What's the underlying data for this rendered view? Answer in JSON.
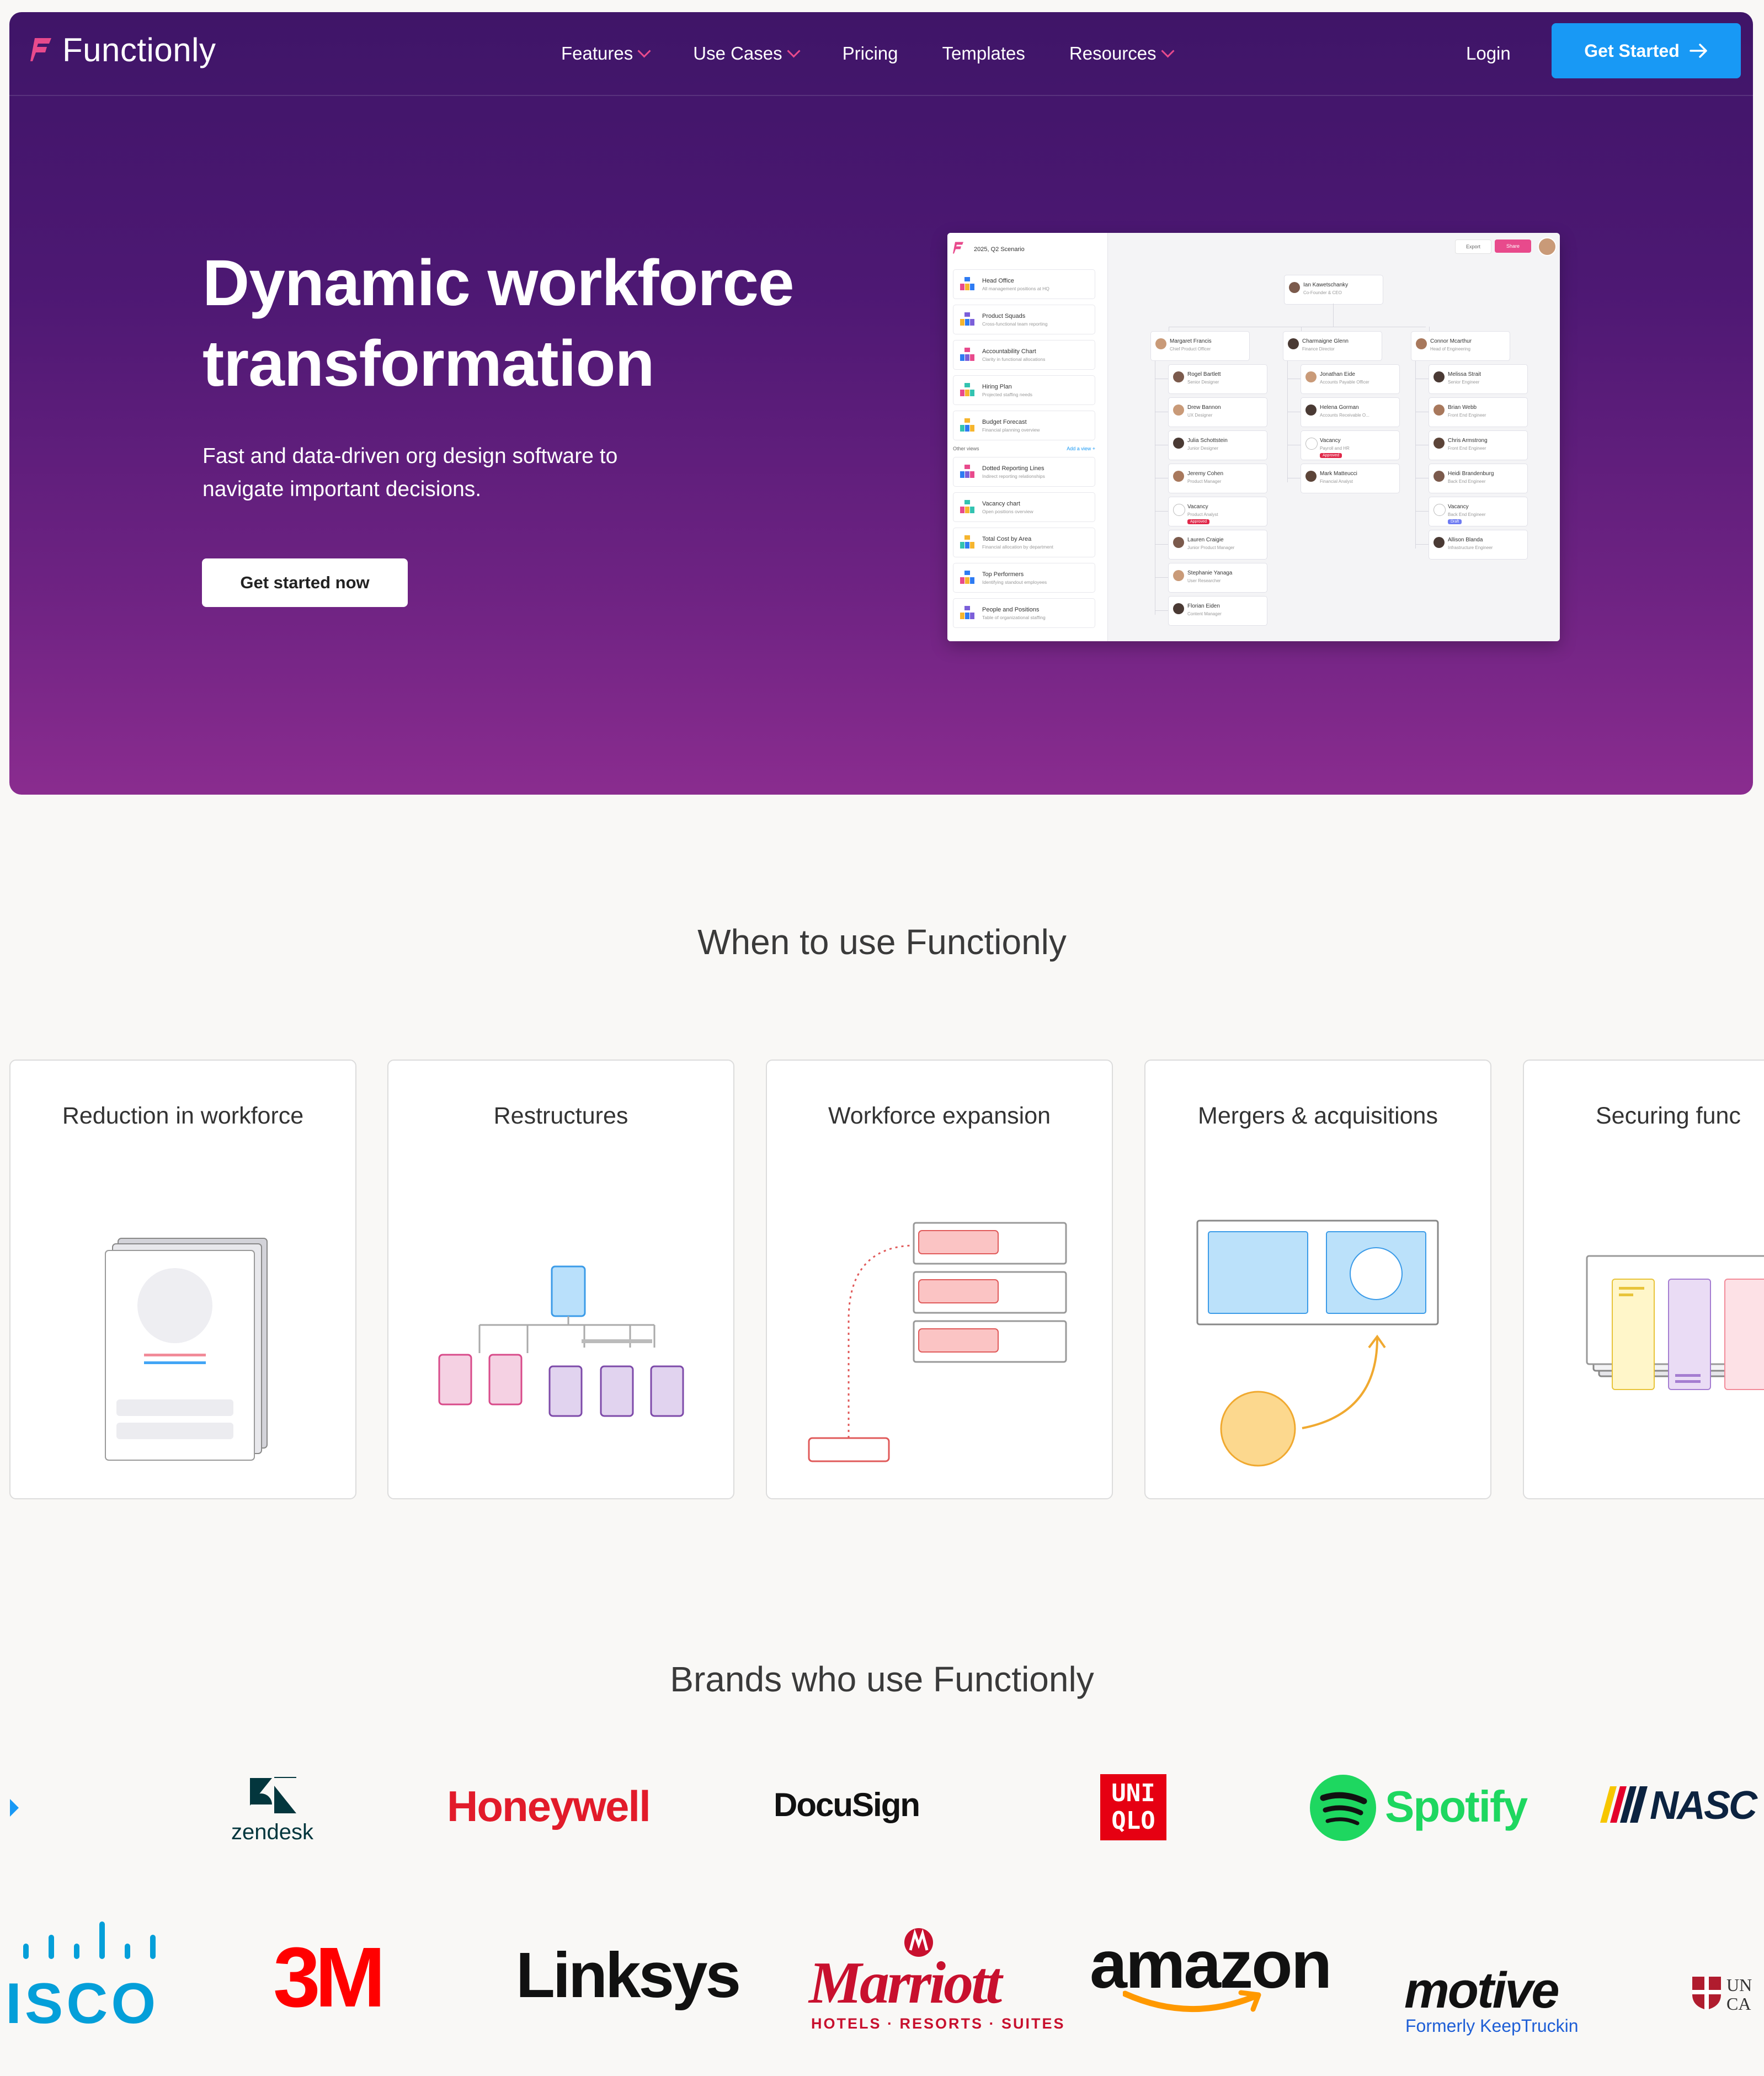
{
  "nav": {
    "logo_text": "Functionly",
    "links": [
      {
        "label": "Features",
        "dropdown": true
      },
      {
        "label": "Use Cases",
        "dropdown": true
      },
      {
        "label": "Pricing",
        "dropdown": false
      },
      {
        "label": "Templates",
        "dropdown": false
      },
      {
        "label": "Resources",
        "dropdown": true
      }
    ],
    "login_label": "Login",
    "cta_label": "Get Started"
  },
  "hero": {
    "title": "Dynamic workforce transformation",
    "subtitle": "Fast and data-driven org design software to navigate important decisions.",
    "button_label": "Get started now"
  },
  "app_preview": {
    "scenario": "2025, Q2 Scenario",
    "export_label": "Export",
    "share_label": "Share",
    "views": [
      {
        "title": "Head Office",
        "sub": "All management positions at HQ"
      },
      {
        "title": "Product Squads",
        "sub": "Cross-functional team reporting"
      },
      {
        "title": "Accountability Chart",
        "sub": "Clarity in functional allocations"
      },
      {
        "title": "Hiring Plan",
        "sub": "Projected staffing needs"
      },
      {
        "title": "Budget Forecast",
        "sub": "Financial planning overview"
      }
    ],
    "other_views_label": "Other views",
    "add_view_label": "Add a view +",
    "other_views": [
      {
        "title": "Dotted Reporting Lines",
        "sub": "Indirect reporting relationships"
      },
      {
        "title": "Vacancy chart",
        "sub": "Open positions overview"
      },
      {
        "title": "Total Cost by Area",
        "sub": "Financial allocation by department"
      },
      {
        "title": "Top Performers",
        "sub": "Identifying standout employees"
      },
      {
        "title": "People and Positions",
        "sub": "Table of organizational staffing"
      }
    ],
    "root": {
      "name": "Ian Kawetschanky",
      "role": "Co-Founder & CEO"
    },
    "columns": [
      {
        "head": {
          "name": "Margaret Francis",
          "role": "Chief Product Officer"
        },
        "members": [
          {
            "name": "Rogel Bartlett",
            "role": "Senior Designer"
          },
          {
            "name": "Drew Bannon",
            "role": "UX Designer"
          },
          {
            "name": "Julia Schottstein",
            "role": "Junior Designer"
          },
          {
            "name": "Jeremy Cohen",
            "role": "Product Manager"
          },
          {
            "name": "Vacancy",
            "role": "Product Analyst",
            "badge": "Approved"
          },
          {
            "name": "Lauren Craigie",
            "role": "Junior Product Manager"
          },
          {
            "name": "Stephanie Yanaga",
            "role": "User Researcher"
          },
          {
            "name": "Florian Eiden",
            "role": "Content Manager"
          }
        ]
      },
      {
        "head": {
          "name": "Charmaigne Glenn",
          "role": "Finance Director"
        },
        "members": [
          {
            "name": "Jonathan Eide",
            "role": "Accounts Payable Officer"
          },
          {
            "name": "Helena Gorman",
            "role": "Accounts Receivable O..."
          },
          {
            "name": "Vacancy",
            "role": "Payroll and HR",
            "badge": "Approved"
          },
          {
            "name": "Mark Matteucci",
            "role": "Financial Analyst"
          }
        ]
      },
      {
        "head": {
          "name": "Connor Mcarthur",
          "role": "Head of Engineering"
        },
        "members": [
          {
            "name": "Melissa Strait",
            "role": "Senior Engineer"
          },
          {
            "name": "Brian Webb",
            "role": "Front End Engineer"
          },
          {
            "name": "Chris Armstrong",
            "role": "Front End Engineer"
          },
          {
            "name": "Heidi Brandenburg",
            "role": "Back End Engineer"
          },
          {
            "name": "Vacancy",
            "role": "Back End Engineer",
            "badge": "Draft"
          },
          {
            "name": "Allison Blanda",
            "role": "Infrastructure Engineer"
          }
        ]
      }
    ]
  },
  "use_cases": {
    "title": "When to use Functionly",
    "cards": [
      {
        "label": "Reduction in workforce"
      },
      {
        "label": "Restructures"
      },
      {
        "label": "Workforce expansion"
      },
      {
        "label": "Mergers & acquisitions"
      },
      {
        "label": "Securing func"
      }
    ]
  },
  "brands": {
    "title": "Brands who use Functionly",
    "row1": [
      "zendesk",
      "Honeywell",
      "DocuSign",
      "UNI QLO",
      "Spotify",
      "NASC"
    ],
    "row2": [
      "ISCO",
      "3M",
      "Linksys",
      "Marriott",
      "HOTELS · RESORTS · SUITES",
      "amazon",
      "motive",
      "Formerly KeepTruckin",
      "UN CA"
    ]
  },
  "colors": {
    "accent": "#e84a8c",
    "cta_blue": "#1899f5",
    "hero_top": "#3f1568",
    "hero_bottom": "#8a2c8f",
    "badge_approved": "#e0294a",
    "badge_draft": "#6e7bf2"
  }
}
